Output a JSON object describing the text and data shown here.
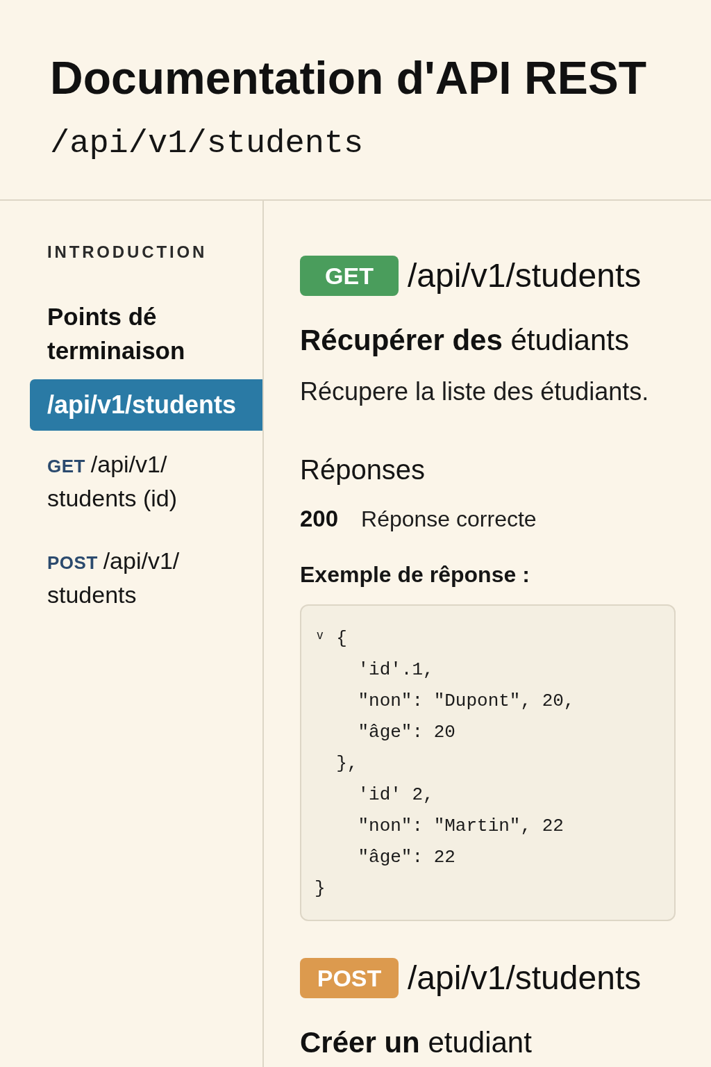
{
  "header": {
    "title": "Documentation d'API REST",
    "subtitle": "/api/v1/students"
  },
  "sidebar": {
    "heading": "INTRODUCTION",
    "group": "Points dé terminaison",
    "items": [
      {
        "label": "/api/v1/students",
        "selected": true
      },
      {
        "method": "GET",
        "label": "/api/v1/students (id)",
        "selected": false
      },
      {
        "method": "POST",
        "label": "/api/v1/students",
        "selected": false
      }
    ]
  },
  "endpoints": [
    {
      "method": "GET",
      "color": "#4a9d5c",
      "path": "/api/v1/students",
      "title": "**Récupérer des** étudiants",
      "description": "Récupere la liste des étudiants.",
      "responses_heading": "Réponses",
      "responses": [
        {
          "code": "200",
          "text": "Réponse correcte"
        }
      ],
      "example_label": "Exemple de rêponse :",
      "example_code": [
        "ᵛ {",
        "    'id'.1,",
        "    \"non\": \"Dupont\", 20,",
        "    \"âge\": 20",
        "  },",
        "    'id' 2,",
        "    \"non\": \"Martin\", 22",
        "    \"âge\": 22",
        "}"
      ]
    },
    {
      "method": "POST",
      "color": "#dc9a4e",
      "path": "/api/v1/students",
      "title": "**Créer un** etudiant"
    }
  ]
}
